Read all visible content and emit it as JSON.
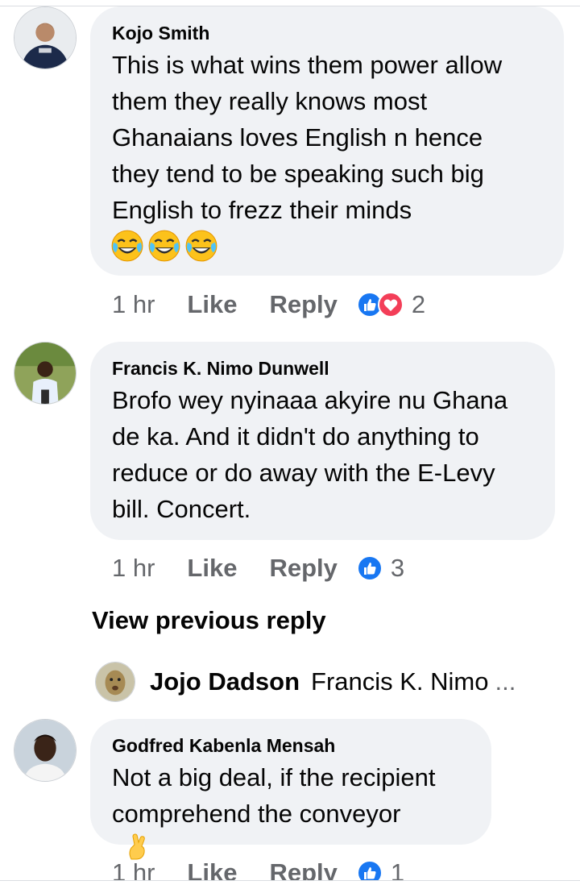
{
  "comments": [
    {
      "author": "Kojo Smith",
      "lines": [
        "This is what wins them power allow",
        "them they really knows most",
        "Ghanaians loves English n hence",
        "they tend to be speaking such big",
        "English to frezz their minds"
      ],
      "emoji": [
        "face-with-tears-of-joy",
        "face-with-tears-of-joy",
        "face-with-tears-of-joy"
      ],
      "time": "1 hr",
      "like_label": "Like",
      "reply_label": "Reply",
      "reactions": [
        "like",
        "love"
      ],
      "reaction_count": "2"
    },
    {
      "author": "Francis K. Nimo Dunwell",
      "lines": [
        "Brofo wey nyinaaa akyire nu Ghana",
        "de ka. And it didn't do anything to",
        "reduce or do away with  the E-Levy",
        "bill. Concert."
      ],
      "time": "1 hr",
      "like_label": "Like",
      "reply_label": "Reply",
      "reactions": [
        "like"
      ],
      "reaction_count": "3"
    },
    {
      "author": "Godfred Kabenla Mensah",
      "lines": [
        "Not a big deal, if the recipient",
        "comprehend the conveyor"
      ],
      "emoji": [
        "crossed-fingers"
      ],
      "time": "1 hr",
      "like_label": "Like",
      "reply_label": "Reply",
      "reactions": [
        "like"
      ],
      "reaction_count": "1"
    }
  ],
  "view_previous_reply": "View previous reply",
  "reply_preview": {
    "author": "Jojo Dadson",
    "text": "Francis K. Nimo",
    "ellipsis": "..."
  },
  "colors": {
    "bubble": "#f0f2f5",
    "meta_text": "#65676b",
    "like_blue": "#1877f2",
    "love_red": "#f33e58"
  }
}
